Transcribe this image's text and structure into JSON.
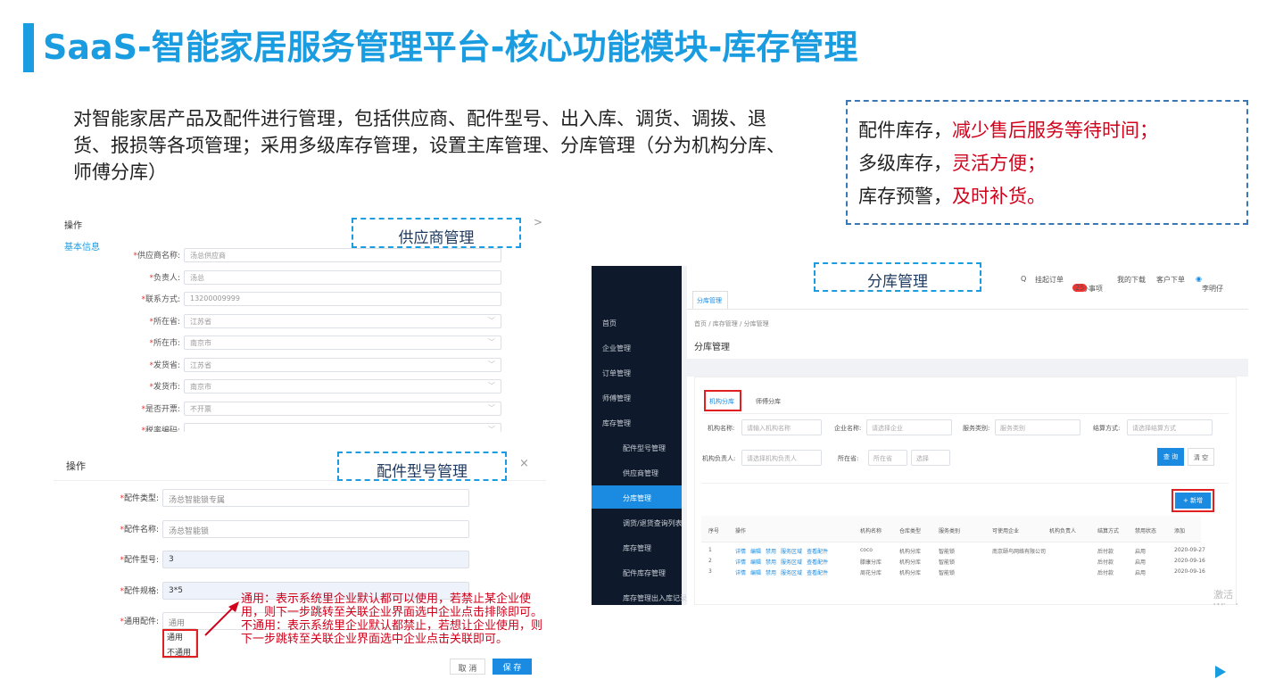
{
  "slide": {
    "title": "SaaS-智能家居服务管理平台-核心功能模块-库存管理",
    "description": "对智能家居产品及配件进行管理，包括供应商、配件型号、出入库、调货、调拨、退货、报损等各项管理；采用多级库存管理，设置主库管理、分库管理（分为机构分库、师傅分库）",
    "callout": {
      "line1_black": "配件库存，",
      "line1_red": "减少售后服务等待时间；",
      "line2_black": "多级库存，",
      "line2_red": "灵活方便；",
      "line3_black": "库存预警，",
      "line3_red": "及时补货。"
    },
    "labels": {
      "supplier": "供应商管理",
      "part_model": "配件型号管理",
      "branch": "分库管理"
    },
    "accent_color": "#1a9ce0",
    "red_color": "#d0021b"
  },
  "supplier_panel": {
    "header": "操作",
    "close": ">",
    "section": "基本信息",
    "fields": [
      {
        "label": "供应商名称:",
        "value": "汤总供应商",
        "select": false
      },
      {
        "label": "负责人:",
        "value": "汤总",
        "select": false
      },
      {
        "label": "联系方式:",
        "value": "13200009999",
        "select": false
      },
      {
        "label": "所在省:",
        "value": "江苏省",
        "select": true
      },
      {
        "label": "所在市:",
        "value": "南京市",
        "select": true
      },
      {
        "label": "发货省:",
        "value": "江苏省",
        "select": true
      },
      {
        "label": "发货市:",
        "value": "南京市",
        "select": true
      },
      {
        "label": "是否开票:",
        "value": "不开票",
        "select": true
      },
      {
        "label": "税率编码:",
        "value": "",
        "select": true
      }
    ]
  },
  "part_panel": {
    "header": "操作",
    "close": "×",
    "fields": [
      {
        "label": "配件类型:",
        "value": "汤总智能锁专属",
        "highlight": false
      },
      {
        "label": "配件名称:",
        "value": "汤总智能锁",
        "highlight": false
      },
      {
        "label": "配件型号:",
        "value": "3",
        "highlight": true
      },
      {
        "label": "配件规格:",
        "value": "3*5",
        "highlight": true
      },
      {
        "label": "通用配件:",
        "value": "通用",
        "highlight": false
      }
    ],
    "dropdown_options": [
      "通用",
      "不通用"
    ],
    "cancel": "取 消",
    "save": "保 存",
    "annotation": "通用：表示系统里企业默认都可以使用，若禁止某企业使用，则下一步跳转至关联企业界面选中企业点击排除即可。不通用：表示系统里企业默认都禁止，若想让企业使用，则下一步跳转至关联企业界面选中企业点击关联即可。"
  },
  "branch_panel": {
    "sidebar": [
      "首页",
      "企业管理",
      "订单管理",
      "师傅管理",
      "库存管理",
      "配件型号管理",
      "供应商管理",
      "分库管理",
      "调货/退货查询列表",
      "库存管理",
      "配件库存管理",
      "库存管理出入库记录"
    ],
    "topnav": {
      "search": "Q",
      "order": "挂起订单",
      "todo": "待办事项",
      "todo_count": "25",
      "download": "我的下载",
      "customer": "客户下单",
      "user": "李明仔"
    },
    "tab": "分库管理",
    "breadcrumb": "首页 / 库存管理 / 分库管理",
    "page_title": "分库管理",
    "subtabs": [
      "机构分库",
      "师傅分库"
    ],
    "filters": {
      "org_name": "机构名称:",
      "org_name_ph": "请输入机构名称",
      "ent_name": "企业名称:",
      "ent_name_ph": "请选择企业",
      "svc_type": "服务类别:",
      "svc_type_ph": "服务类别",
      "settle": "结算方式:",
      "settle_ph": "请选择结算方式",
      "owner": "机构负责人:",
      "owner_ph": "请选择机构负责人",
      "loc": "所在省:",
      "loc_ph": "所在省",
      "loc_ph2": "选择"
    },
    "query": "查 询",
    "clear": "清 空",
    "add": "+ 新增",
    "columns": [
      "序号",
      "操作",
      "机构名称",
      "仓库类型",
      "服务类别",
      "可使用企业",
      "机构负责人",
      "结算方式",
      "禁用状态",
      "添加"
    ],
    "actions": [
      "详情",
      "编辑",
      "禁用",
      "服务区域",
      "查看配件"
    ],
    "rows": [
      {
        "no": "1",
        "name": "coco",
        "type": "机构分库",
        "svc": "智能锁",
        "ent": "南京颐鸟网络有限公司",
        "owner": "",
        "settle": "后付款",
        "state": "启用",
        "date": "2020-09-27"
      },
      {
        "no": "2",
        "name": "滕康分库",
        "type": "机构分库",
        "svc": "智能锁",
        "ent": "",
        "owner": "",
        "settle": "后付款",
        "state": "启用",
        "date": "2020-09-16"
      },
      {
        "no": "3",
        "name": "周花分库",
        "type": "机构分库",
        "svc": "智能锁",
        "ent": "",
        "owner": "",
        "settle": "后付款",
        "state": "启用",
        "date": "2020-09-16"
      }
    ],
    "watermark": "激活 Windows"
  }
}
